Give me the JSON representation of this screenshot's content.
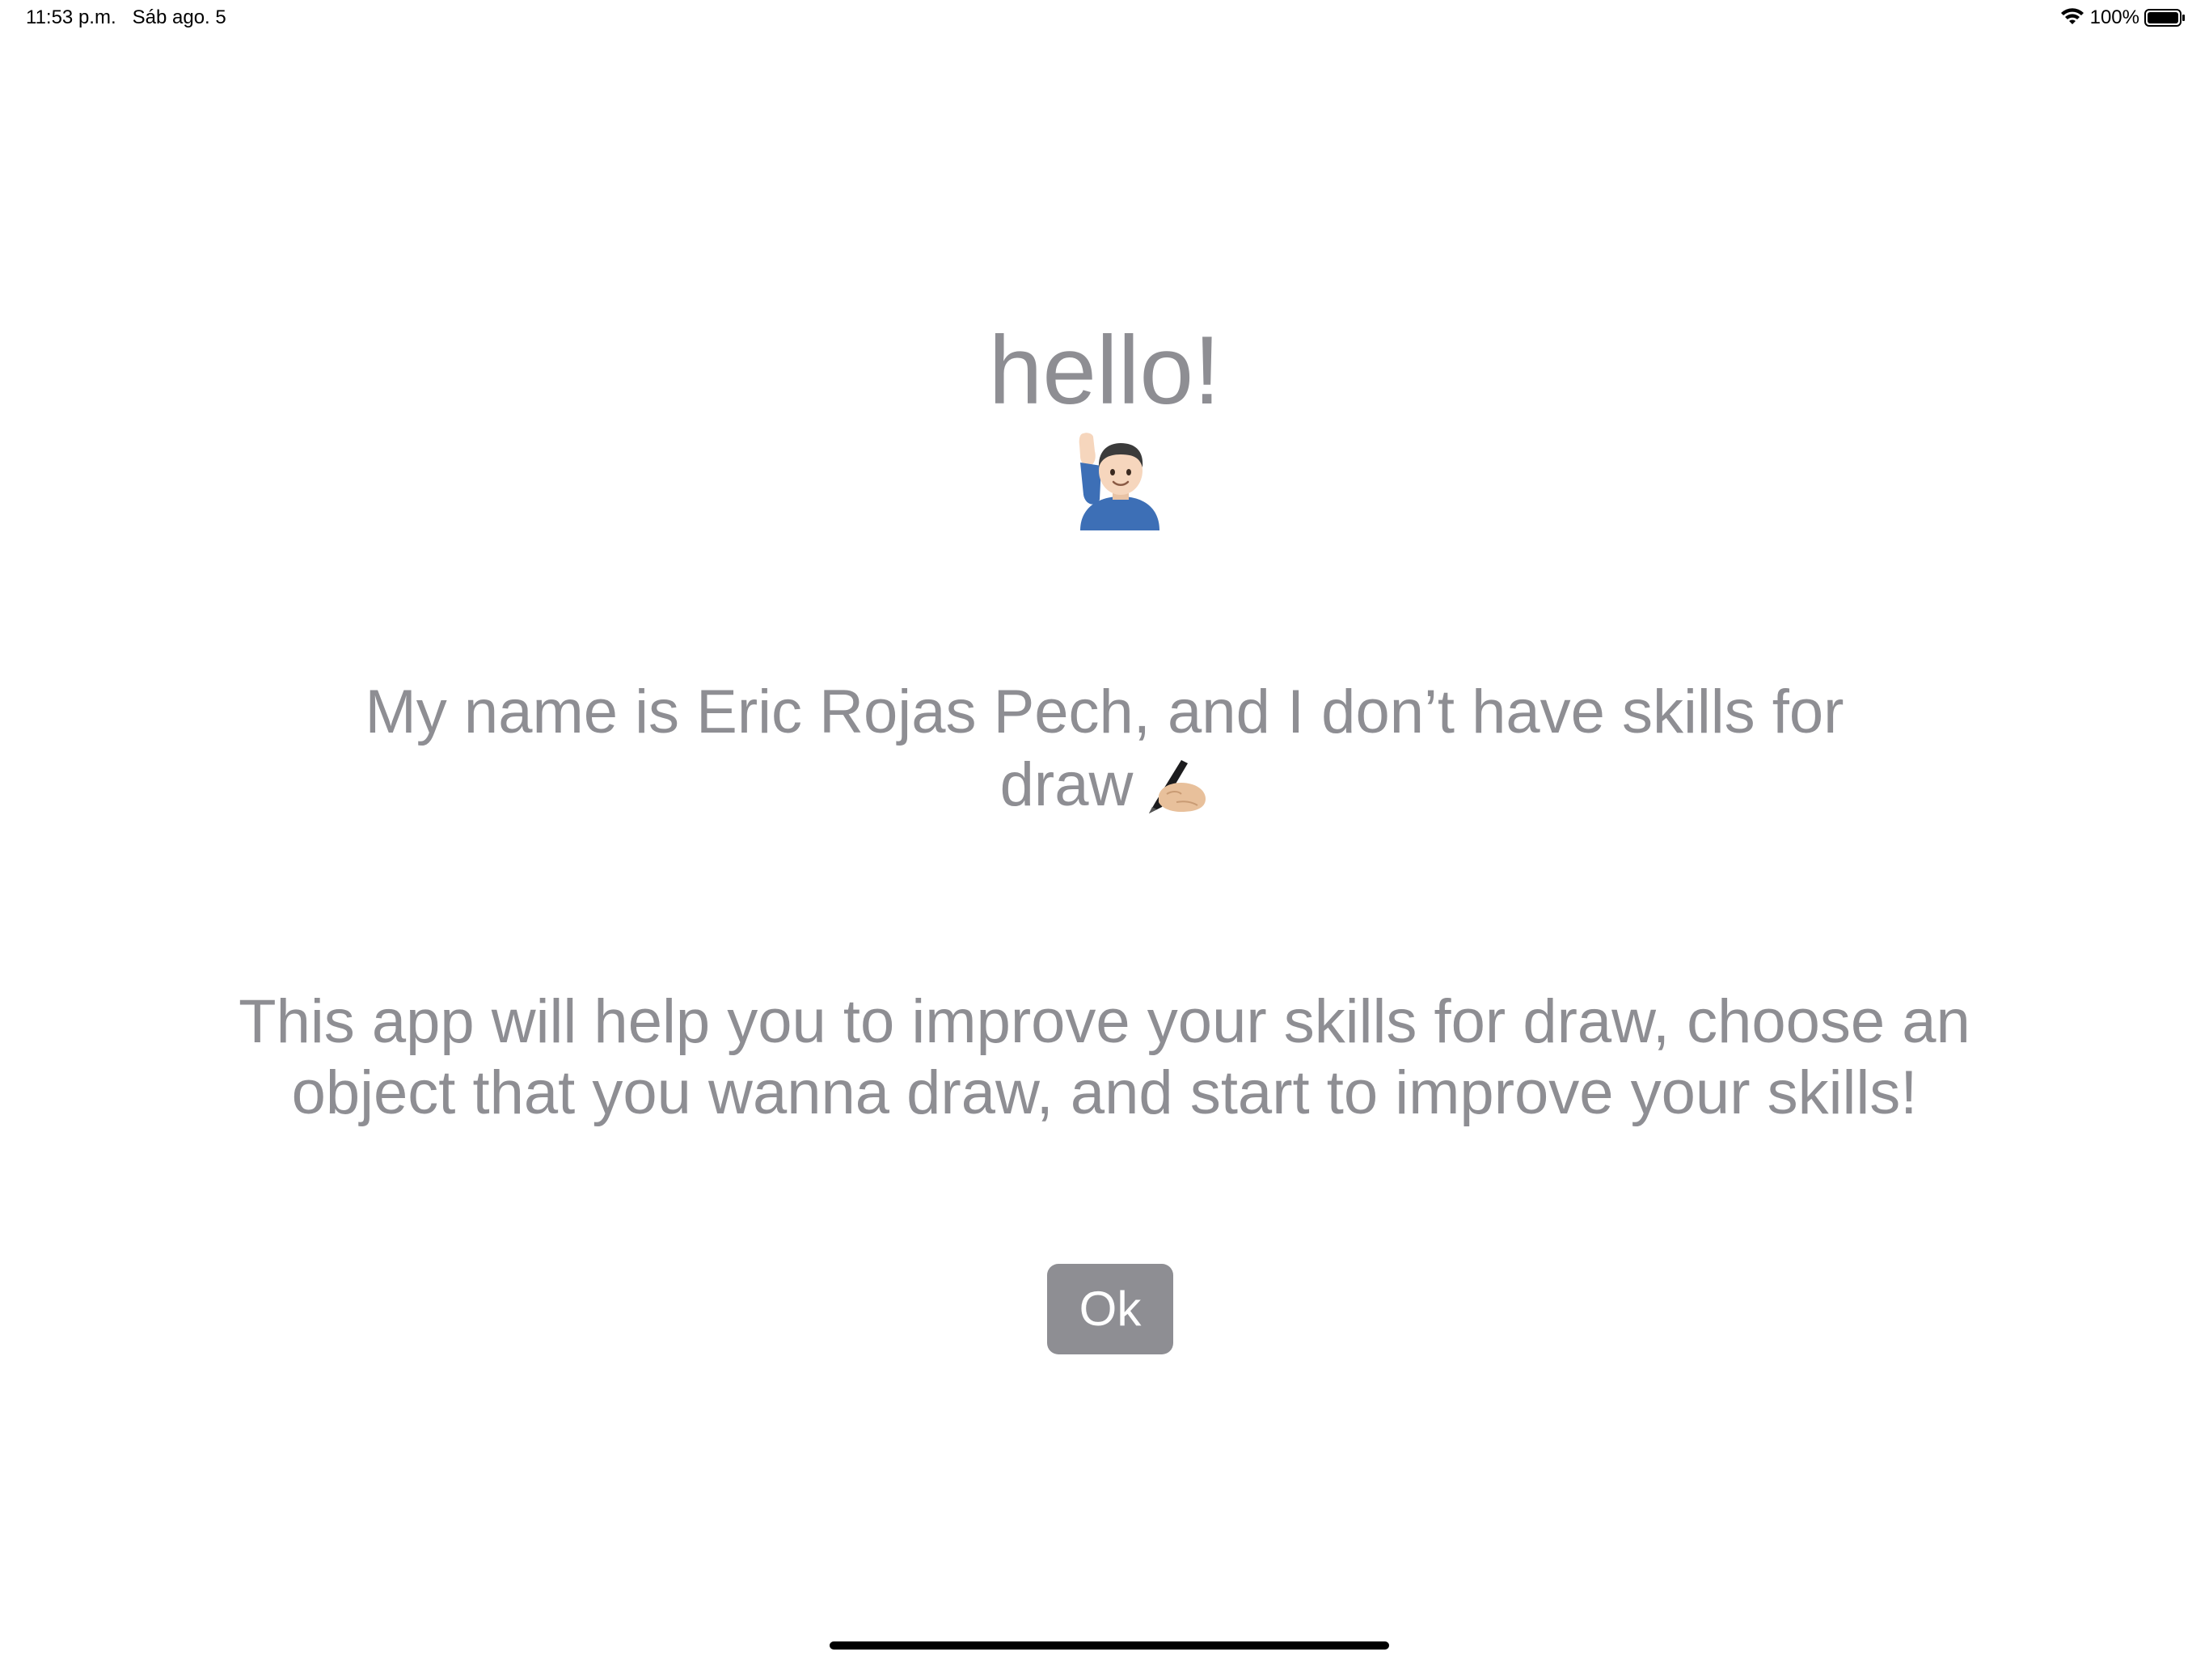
{
  "status_bar": {
    "time": "11:53 p.m.",
    "date": "Sáb ago. 5",
    "battery": "100%",
    "icons": [
      "wifi-icon",
      "battery-icon"
    ]
  },
  "welcome": {
    "title": "hello!",
    "title_emoji": "person-raising-hand-icon",
    "intro": "My name is Eric Rojas Pech, and I don’t have skills for draw",
    "intro_emoji": "writing-hand-icon",
    "description": "This app will help you to improve your skills for draw, choose an object that you wanna draw, and start to improve your skills!",
    "ok_label": "Ok"
  },
  "colors": {
    "text_gray": "#8e8e93",
    "button_bg": "#8e8e93",
    "button_text": "#ffffff",
    "background": "#ffffff"
  }
}
